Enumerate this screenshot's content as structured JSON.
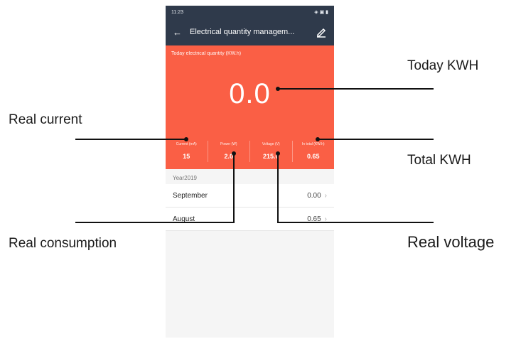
{
  "status_bar": {
    "time": "11:23",
    "right_icons": "◈ ▣ ▮"
  },
  "appbar": {
    "title": "Electrical quantity managem...",
    "back_icon": "arrow-left",
    "edit_icon": "pencil"
  },
  "today": {
    "label": "Today electrical quantity (KW.h)",
    "value": "0.0"
  },
  "stats": [
    {
      "label": "Current (mA)",
      "value": "15"
    },
    {
      "label": "Power (W)",
      "value": "2.0"
    },
    {
      "label": "Voltage (V)",
      "value": "215.0"
    },
    {
      "label": "In total (KW.h)",
      "value": "0.65"
    }
  ],
  "history": {
    "year": "Year2019",
    "months": [
      {
        "name": "September",
        "value": "0.00"
      },
      {
        "name": "August",
        "value": "0.65"
      }
    ]
  },
  "callouts": {
    "today_kwh": "Today KWH",
    "real_current": "Real current",
    "total_kwh": "Total KWH",
    "real_consumption": "Real consumption",
    "real_voltage": "Real voltage"
  },
  "colors": {
    "appbar": "#2f3a4b",
    "accent": "#fa5f45",
    "background": "#f5f5f5"
  }
}
